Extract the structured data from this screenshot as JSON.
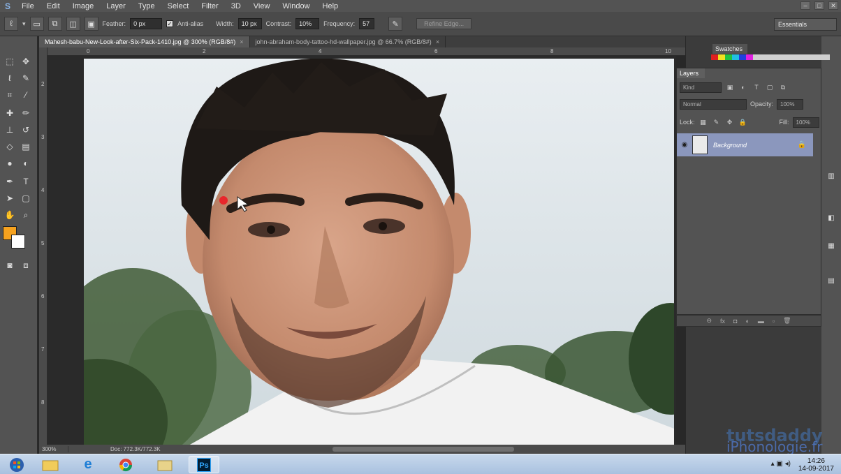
{
  "menu": {
    "items": [
      "File",
      "Edit",
      "Image",
      "Layer",
      "Type",
      "Select",
      "Filter",
      "3D",
      "View",
      "Window",
      "Help"
    ]
  },
  "options": {
    "feather_label": "Feather:",
    "feather_value": "0 px",
    "antialias_label": "Anti-alias",
    "width_label": "Width:",
    "width_value": "10 px",
    "contrast_label": "Contrast:",
    "contrast_value": "10%",
    "frequency_label": "Frequency:",
    "frequency_value": "57",
    "refine_edge": "Refine Edge...",
    "workspace": "Essentials"
  },
  "document_tabs": [
    {
      "label": "Mahesh-babu-New-Look-after-Six-Pack-1410.jpg @ 300% (RGB/8#)",
      "active": true
    },
    {
      "label": "john-abraham-body-tattoo-hd-wallpaper.jpg @ 66.7% (RGB/8#)",
      "active": false
    }
  ],
  "rulers": {
    "horizontal": [
      "0",
      "2",
      "4",
      "6",
      "8",
      "10"
    ],
    "vertical": [
      "2",
      "3",
      "4",
      "5",
      "6",
      "7",
      "8"
    ]
  },
  "status": {
    "zoom": "300%",
    "doc": "Doc: 772.3K/772.3K"
  },
  "panels": {
    "swatches_tab": "Swatches",
    "layers_tab": "Layers",
    "kind": "Kind",
    "blend_mode": "Normal",
    "opacity_label": "Opacity:",
    "opacity_value": "100%",
    "lock_label": "Lock:",
    "fill_label": "Fill:",
    "fill_value": "100%",
    "layer_name": "Background"
  },
  "watermarks": {
    "tutsdaddy": "tutsdaddy",
    "iphonologie": "iPhonologie.fr"
  },
  "taskbar": {
    "time": "14:26",
    "date": "14-09-2017"
  },
  "colors": {
    "foreground": "#f6a21e",
    "background": "#ffffff",
    "layer_selected": "#8b97bd"
  }
}
